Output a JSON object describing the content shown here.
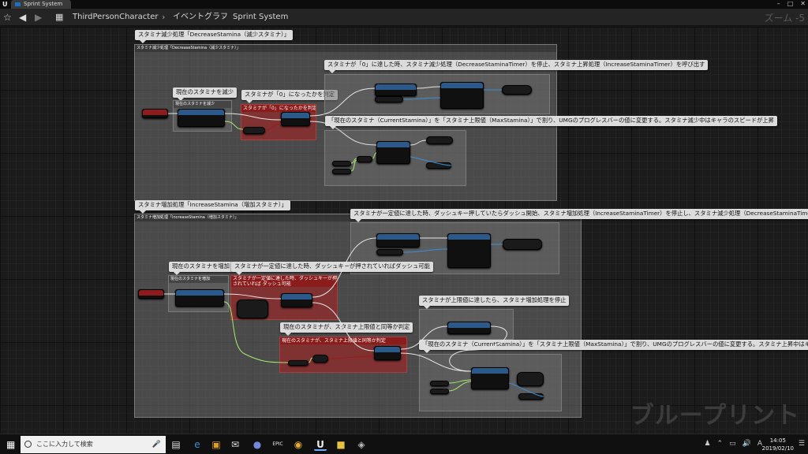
{
  "window": {
    "tab_title": "Sprint System"
  },
  "breadcrumb": {
    "items": [
      "ThirdPersonCharacter",
      "イベントグラフ",
      "Sprint System"
    ]
  },
  "graph": {
    "zoom_label": "ズーム -5",
    "watermark": "ブループリント",
    "sections": {
      "decrease": {
        "bubble": "スタミナ減少処理「DecreaseStamina（減少スタミナ）」",
        "header": "スタミナ減少処理「DecreaseStamina（減少スタミナ）」",
        "notes": {
          "reduce": "現在のスタミナを減少",
          "reduce_head": "現在のスタミナを減少",
          "zero_check": "スタミナが「0」になったかを判定",
          "zero_check_head": "スタミナが「0」になったかを判定",
          "zero_reached": "スタミナが「0」に達した時、スタミナ減少処理（DecreaseStaminaTimer）を停止、スタミナ上昇処理（IncreaseStaminaTimer）を呼び出す",
          "progress": "「現在のスタミナ（CurrentStamina）」を「スタミナ上限値（MaxStamina）」で割り、UMGのプログレスバーの値に変更する。スタミナ減少中はキャラのスピードが上昇"
        }
      },
      "increase": {
        "bubble": "スタミナ増加処理「IncreaseStamina（増加スタミナ）」",
        "header": "スタミナ増加処理「IncreaseStamina（増加スタミナ）」",
        "notes": {
          "threshold_reached": "スタミナが一定値に達した時、ダッシュキー押していたらダッシュ開始、スタミナ増加処理（IncreaseStaminaTimer）を停止し、スタミナ減少処理（DecreaseStaminaTimer）を呼び出す",
          "increase": "現在のスタミナを増加",
          "increase_head": "現在のスタミナを増加",
          "threshold_check": "スタミナが一定値に達した時、ダッシュキーが押されていればダッシュ可能",
          "threshold_check_head": "スタミナが一定値に達した時、ダッシュキーが押されていれば ダッシュ可能",
          "max_check": "現在のスタミナが、スタミナ上限値と同等か判定",
          "max_check_head": "現在のスタミナが、スタミナ上限値と同等か判定",
          "max_reached": "スタミナが上限値に達したら、スタミナ増加処理を停止",
          "progress": "「現在のスタミナ（CurrentStamina）」を「スタミナ上限値（MaxStamina）」で割り、UMGのプログレスバーの値に変更する。スタミナ上昇中はキャラのスピードが元に戻る"
        }
      }
    }
  },
  "taskbar": {
    "search_placeholder": "ここに入力して検索",
    "clock_time": "14:05",
    "clock_date": "2019/02/10"
  },
  "colors": {
    "accent": "#1d6fc2",
    "exec_wire": "#e6e6e6",
    "float_wire": "#a7e86d",
    "object_wire": "#3b8fd6",
    "comment_red": "#8a1c1c"
  }
}
